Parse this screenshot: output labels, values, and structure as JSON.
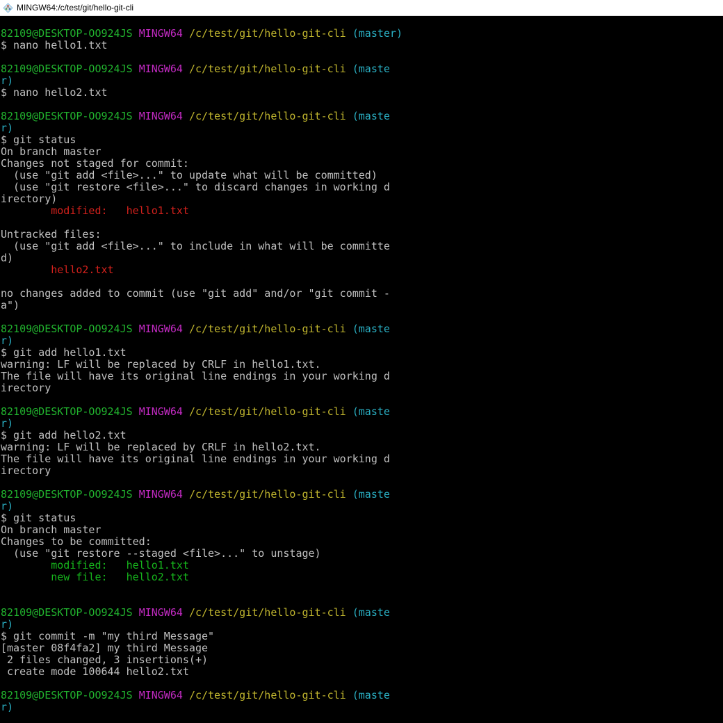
{
  "window": {
    "title": "MINGW64:/c/test/git/hello-git-cli",
    "icon": "git-bash-icon"
  },
  "colors": {
    "background": "#000000",
    "text": "#c0c0c0",
    "user_host": "#21b32e",
    "mingw": "#c22ac2",
    "path": "#c0b52e",
    "branch": "#2ab0c4",
    "red": "#d3211c",
    "green": "#16b51c"
  },
  "lines": [
    {
      "type": "prompt",
      "user": "82109@DESKTOP-OO924JS",
      "env": "MINGW64",
      "path": "/c/test/git/hello-git-cli",
      "branch": "(master)"
    },
    {
      "type": "text",
      "text": "$ nano hello1.txt"
    },
    {
      "type": "blank"
    },
    {
      "type": "prompt",
      "user": "82109@DESKTOP-OO924JS",
      "env": "MINGW64",
      "path": "/c/test/git/hello-git-cli",
      "branch": "(maste"
    },
    {
      "type": "branch",
      "text": "r)"
    },
    {
      "type": "text",
      "text": "$ nano hello2.txt"
    },
    {
      "type": "blank"
    },
    {
      "type": "prompt",
      "user": "82109@DESKTOP-OO924JS",
      "env": "MINGW64",
      "path": "/c/test/git/hello-git-cli",
      "branch": "(maste"
    },
    {
      "type": "branch",
      "text": "r)"
    },
    {
      "type": "text",
      "text": "$ git status"
    },
    {
      "type": "text",
      "text": "On branch master"
    },
    {
      "type": "text",
      "text": "Changes not staged for commit:"
    },
    {
      "type": "text",
      "text": "  (use \"git add <file>...\" to update what will be committed)"
    },
    {
      "type": "text",
      "text": "  (use \"git restore <file>...\" to discard changes in working d"
    },
    {
      "type": "text",
      "text": "irectory)"
    },
    {
      "type": "red",
      "text": "        modified:   hello1.txt"
    },
    {
      "type": "blank"
    },
    {
      "type": "text",
      "text": "Untracked files:"
    },
    {
      "type": "text",
      "text": "  (use \"git add <file>...\" to include in what will be committe"
    },
    {
      "type": "text",
      "text": "d)"
    },
    {
      "type": "red",
      "text": "        hello2.txt"
    },
    {
      "type": "blank"
    },
    {
      "type": "text",
      "text": "no changes added to commit (use \"git add\" and/or \"git commit -"
    },
    {
      "type": "text",
      "text": "a\")"
    },
    {
      "type": "blank"
    },
    {
      "type": "prompt",
      "user": "82109@DESKTOP-OO924JS",
      "env": "MINGW64",
      "path": "/c/test/git/hello-git-cli",
      "branch": "(maste"
    },
    {
      "type": "branch",
      "text": "r)"
    },
    {
      "type": "text",
      "text": "$ git add hello1.txt"
    },
    {
      "type": "text",
      "text": "warning: LF will be replaced by CRLF in hello1.txt."
    },
    {
      "type": "text",
      "text": "The file will have its original line endings in your working d"
    },
    {
      "type": "text",
      "text": "irectory"
    },
    {
      "type": "blank"
    },
    {
      "type": "prompt",
      "user": "82109@DESKTOP-OO924JS",
      "env": "MINGW64",
      "path": "/c/test/git/hello-git-cli",
      "branch": "(maste"
    },
    {
      "type": "branch",
      "text": "r)"
    },
    {
      "type": "text",
      "text": "$ git add hello2.txt"
    },
    {
      "type": "text",
      "text": "warning: LF will be replaced by CRLF in hello2.txt."
    },
    {
      "type": "text",
      "text": "The file will have its original line endings in your working d"
    },
    {
      "type": "text",
      "text": "irectory"
    },
    {
      "type": "blank"
    },
    {
      "type": "prompt",
      "user": "82109@DESKTOP-OO924JS",
      "env": "MINGW64",
      "path": "/c/test/git/hello-git-cli",
      "branch": "(maste"
    },
    {
      "type": "branch",
      "text": "r)"
    },
    {
      "type": "text",
      "text": "$ git status"
    },
    {
      "type": "text",
      "text": "On branch master"
    },
    {
      "type": "text",
      "text": "Changes to be committed:"
    },
    {
      "type": "text",
      "text": "  (use \"git restore --staged <file>...\" to unstage)"
    },
    {
      "type": "green",
      "text": "        modified:   hello1.txt"
    },
    {
      "type": "green",
      "text": "        new file:   hello2.txt"
    },
    {
      "type": "blank"
    },
    {
      "type": "blank"
    },
    {
      "type": "prompt",
      "user": "82109@DESKTOP-OO924JS",
      "env": "MINGW64",
      "path": "/c/test/git/hello-git-cli",
      "branch": "(maste"
    },
    {
      "type": "branch",
      "text": "r)"
    },
    {
      "type": "text",
      "text": "$ git commit -m \"my third Message\""
    },
    {
      "type": "text",
      "text": "[master 08f4fa2] my third Message"
    },
    {
      "type": "text",
      "text": " 2 files changed, 3 insertions(+)"
    },
    {
      "type": "text",
      "text": " create mode 100644 hello2.txt"
    },
    {
      "type": "blank"
    },
    {
      "type": "prompt",
      "user": "82109@DESKTOP-OO924JS",
      "env": "MINGW64",
      "path": "/c/test/git/hello-git-cli",
      "branch": "(maste"
    },
    {
      "type": "branch",
      "text": "r)"
    }
  ]
}
